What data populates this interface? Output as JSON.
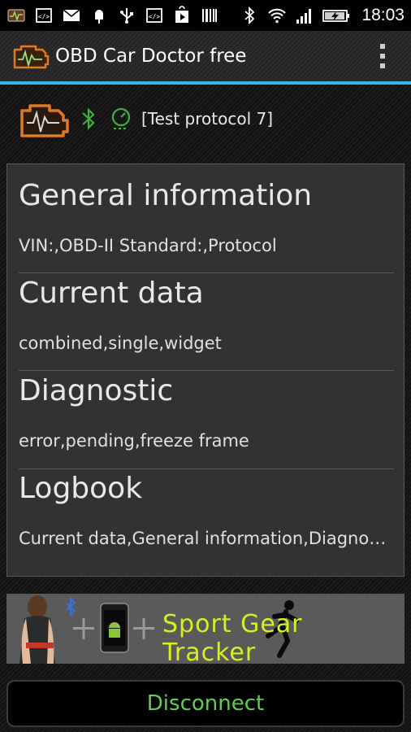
{
  "statusbar": {
    "left_icons": [
      "app-notification-icon",
      "code-icon",
      "mail-icon",
      "popsicle-icon",
      "usb-icon",
      "code-icon",
      "play-store-icon",
      "barcode-icon"
    ],
    "right_icons": [
      "bluetooth-icon",
      "wifi-icon",
      "signal-icon",
      "battery-charging-icon"
    ],
    "time": "18:03"
  },
  "actionbar": {
    "title": "OBD Car Doctor free",
    "accent_color": "#33b5e5"
  },
  "connection": {
    "protocol": "[Test protocol 7]",
    "engine_icon_color": "#e07a1f",
    "status_icon_color": "#3fb23a"
  },
  "menu": {
    "items": [
      {
        "title": "General information",
        "subtitle": "VIN:,OBD-II Standard:,Protocol"
      },
      {
        "title": "Current data",
        "subtitle": "combined,single,widget"
      },
      {
        "title": "Diagnostic",
        "subtitle": "error,pending,freeze frame"
      },
      {
        "title": "Logbook",
        "subtitle": "Current data,General information,Diagnostic"
      }
    ]
  },
  "ad": {
    "text": "Sport Gear Tracker",
    "text_color": "#d8f020"
  },
  "disconnect": {
    "label": "Disconnect",
    "label_color": "#5ed14a"
  }
}
